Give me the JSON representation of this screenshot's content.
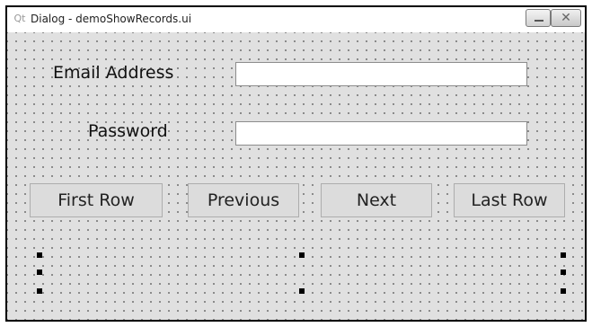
{
  "window": {
    "title": "Dialog - demoShowRecords.ui",
    "app_icon": "qt-icon",
    "minimize_icon": "minimize-icon",
    "close_icon": "close-icon"
  },
  "form": {
    "email_label": "Email Address",
    "email_value": "",
    "password_label": "Password",
    "password_value": ""
  },
  "buttons": {
    "first": "First Row",
    "previous": "Previous",
    "next": "Next",
    "last": "Last Row"
  }
}
